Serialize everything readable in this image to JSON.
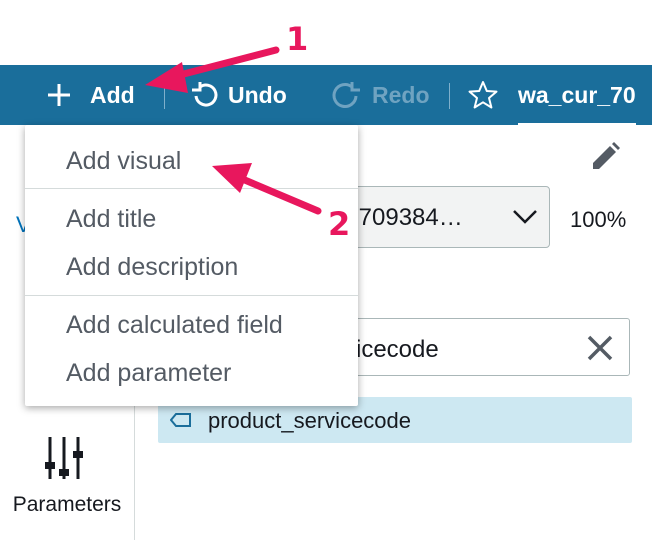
{
  "toolbar": {
    "add_label": "Add",
    "undo_label": "Undo",
    "redo_label": "Redo",
    "title_value": "wa_cur_70",
    "add_icon": "plus-icon",
    "undo_icon": "undo-icon",
    "redo_icon": "redo-icon",
    "favorite_icon": "star-icon",
    "background_color": "#1a6e9b"
  },
  "panel": {
    "cut_visual_char": "V",
    "dataset_value": ".709384…",
    "zoom": "100%",
    "search_value": "icecode",
    "field_item": "product_servicecode",
    "parameters_label": "Parameters",
    "edit_icon": "pencil-icon",
    "clear_icon": "close-icon",
    "parameters_icon": "sliders-icon",
    "field_icon": "tag-icon"
  },
  "menu": {
    "items": [
      {
        "label": "Add visual"
      },
      {
        "label": "Add title"
      },
      {
        "label": "Add description"
      },
      {
        "label": "Add calculated field"
      },
      {
        "label": "Add parameter"
      }
    ]
  },
  "annotations": {
    "step1": "1",
    "step2": "2",
    "color": "#e8175d"
  }
}
